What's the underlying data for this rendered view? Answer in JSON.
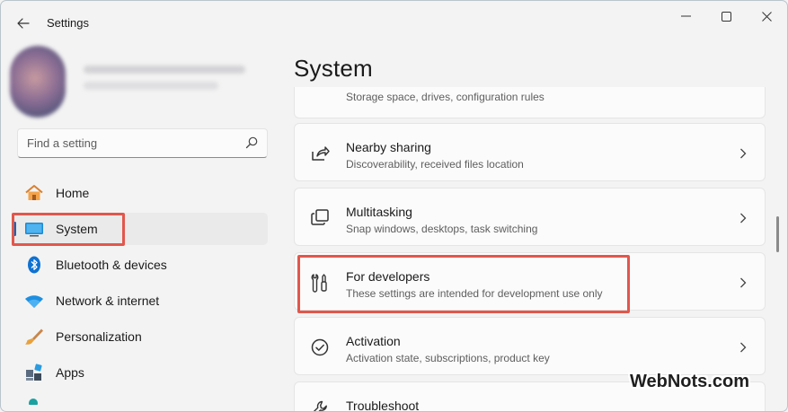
{
  "window": {
    "title": "Settings"
  },
  "search": {
    "placeholder": "Find a setting"
  },
  "sidebar": {
    "items": [
      {
        "label": "Home",
        "icon": "home-icon"
      },
      {
        "label": "System",
        "icon": "system-icon",
        "active": true
      },
      {
        "label": "Bluetooth & devices",
        "icon": "bluetooth-icon"
      },
      {
        "label": "Network & internet",
        "icon": "wifi-icon"
      },
      {
        "label": "Personalization",
        "icon": "brush-icon"
      },
      {
        "label": "Apps",
        "icon": "apps-icon"
      }
    ]
  },
  "main": {
    "title": "System",
    "cards": [
      {
        "title": "",
        "subtitle": "Storage space, drives, configuration rules",
        "icon": "storage-icon"
      },
      {
        "title": "Nearby sharing",
        "subtitle": "Discoverability, received files location",
        "icon": "share-icon"
      },
      {
        "title": "Multitasking",
        "subtitle": "Snap windows, desktops, task switching",
        "icon": "multitasking-icon"
      },
      {
        "title": "For developers",
        "subtitle": "These settings are intended for development use only",
        "icon": "developer-tools-icon"
      },
      {
        "title": "Activation",
        "subtitle": "Activation state, subscriptions, product key",
        "icon": "activation-check-icon"
      },
      {
        "title": "Troubleshoot",
        "subtitle": "",
        "icon": "wrench-icon"
      }
    ]
  },
  "watermark": "WebNots.com",
  "colors": {
    "accent": "#0067c0",
    "highlight": "#e1574c",
    "background": "#f3f3f3"
  }
}
